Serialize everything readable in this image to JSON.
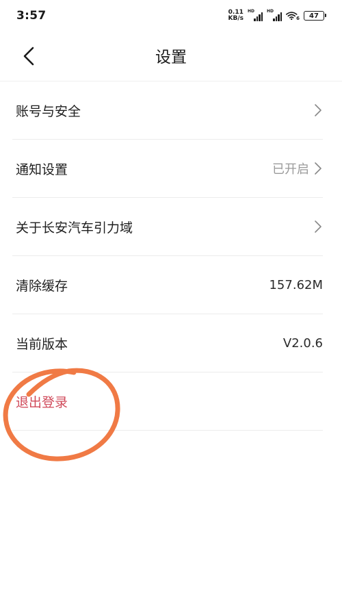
{
  "status_bar": {
    "time": "3:57",
    "net_speed_value": "0.11",
    "net_speed_unit": "KB/s",
    "signal1_label": "HD",
    "signal2_label": "HD",
    "wifi_badge": "6",
    "battery": "47"
  },
  "nav": {
    "title": "设置"
  },
  "settings": {
    "items": [
      {
        "label": "账号与安全",
        "value": ""
      },
      {
        "label": "通知设置",
        "value": "已开启"
      },
      {
        "label": "关于长安汽车引力域",
        "value": ""
      },
      {
        "label": "清除缓存",
        "value": "157.62M"
      },
      {
        "label": "当前版本",
        "value": "V2.0.6"
      }
    ],
    "logout_label": "退出登录"
  },
  "colors": {
    "logout": "#d04a5a",
    "annotation": "#f07a45",
    "secondary_text": "#9a9a9a",
    "divider": "#ececec"
  }
}
